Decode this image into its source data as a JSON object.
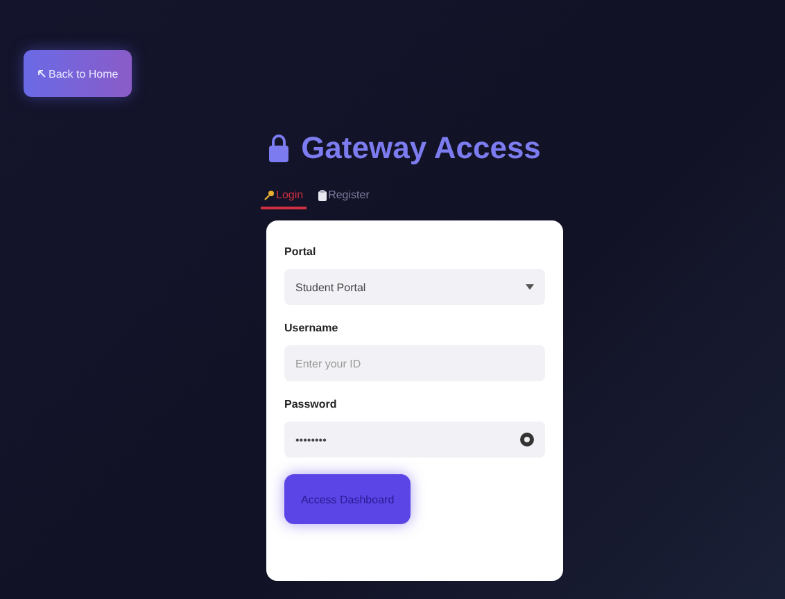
{
  "back_button": {
    "label": "Back to Home"
  },
  "title": "Gateway Access",
  "tabs": [
    {
      "label": "Login",
      "selected": true
    },
    {
      "label": "Register",
      "selected": false
    }
  ],
  "form": {
    "portal": {
      "label": "Portal",
      "value": "Student Portal"
    },
    "username": {
      "label": "Username",
      "placeholder": "Enter your ID"
    },
    "password": {
      "label": "Password",
      "value": "••••••••"
    },
    "submit": "Access Dashboard"
  }
}
